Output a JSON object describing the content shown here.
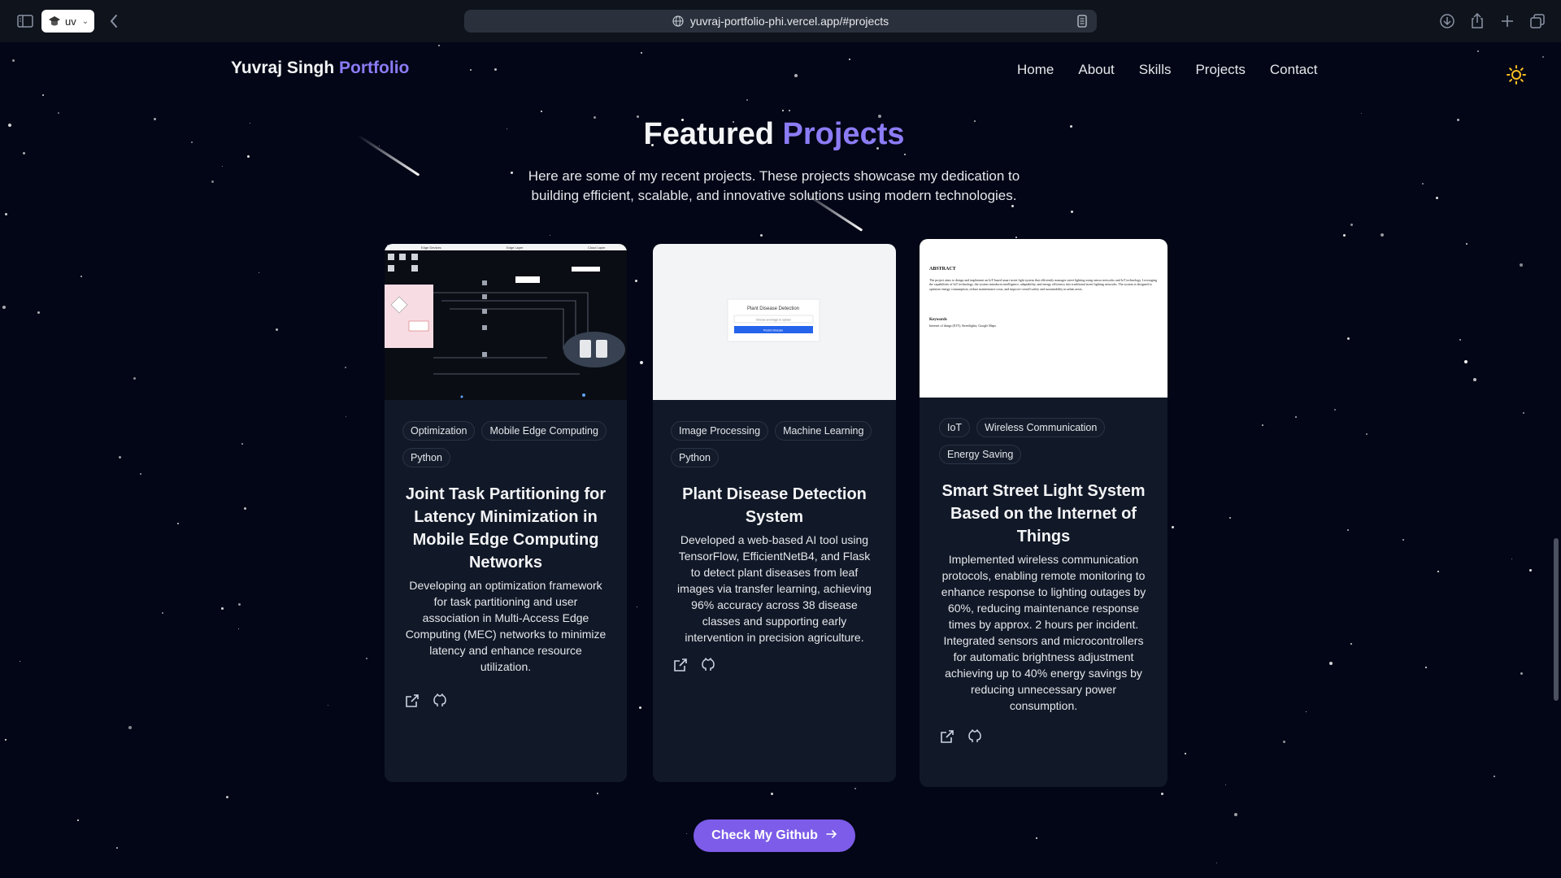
{
  "browser": {
    "profile_label": "uv",
    "url": "yuvraj-portfolio-phi.vercel.app/#projects",
    "icons": [
      "sidebar-icon",
      "back-icon",
      "globe-icon",
      "reader-icon",
      "download-icon",
      "share-icon",
      "new-tab-icon",
      "tabs-overview-icon"
    ]
  },
  "header": {
    "brand_name": "Yuvraj Singh",
    "brand_accent": "Portfolio",
    "nav": [
      "Home",
      "About",
      "Skills",
      "Projects",
      "Contact"
    ],
    "theme_icon": "sun-icon"
  },
  "section": {
    "title_main": "Featured",
    "title_accent": "Projects",
    "subtitle": "Here are some of my recent projects. These projects showcase my dedication to building efficient, scalable, and innovative solutions using modern technologies."
  },
  "projects": [
    {
      "tags": [
        "Optimization",
        "Mobile Edge Computing",
        "Python"
      ],
      "title": "Joint Task Partitioning for Latency Minimization in Mobile Edge Computing Networks",
      "description": "Developing an optimization framework for task partitioning and user association in Multi-Access Edge Computing (MEC) networks to minimize latency and enhance resource utilization.",
      "thumb_texts": [
        "Edge Devices",
        "Edge Layer",
        "Cloud Layer"
      ]
    },
    {
      "tags": [
        "Image Processing",
        "Machine Learning",
        "Python"
      ],
      "title": "Plant Disease Detection System",
      "description": "Developed a web-based AI tool using TensorFlow, EfficientNetB4, and Flask to detect plant diseases from leaf images via transfer learning, achieving 96% accuracy across 38 disease classes and supporting early intervention in precision agriculture.",
      "thumb_texts": [
        "Plant Disease Detection",
        "Choose an image to upload",
        "Predict Disease"
      ]
    },
    {
      "tags": [
        "IoT",
        "Wireless Communication",
        "Energy Saving"
      ],
      "title": "Smart Street Light System Based on the Internet of Things",
      "description": "Implemented wireless communication protocols, enabling remote monitoring to enhance response to lighting outages by 60%, reducing maintenance response times by approx. 2 hours per incident. Integrated sensors and microcontrollers for automatic brightness adjustment achieving up to 40% energy savings by reducing unnecessary power consumption.",
      "thumb_texts": [
        "ABSTRACT",
        "The project aims to design and implement an IoT-based smart street light system that efficiently manages street lighting using sensor networks and IoT technology. Leveraging the capabilities of IoT technology, the system introduces intelligence, adaptability, and energy efficiency into traditional street lighting networks. The system is designed to optimize energy consumption, reduce maintenance costs, and improve overall safety and sustainability in urban areas.",
        "Keywords",
        "Internet of things (IOT); Streetlights; Google Maps."
      ]
    }
  ],
  "cta": {
    "label": "Check My Github"
  },
  "colors": {
    "background": "#020616",
    "card": "#111827",
    "accent": "#8b7cf6",
    "button": "#7c5ce8"
  }
}
